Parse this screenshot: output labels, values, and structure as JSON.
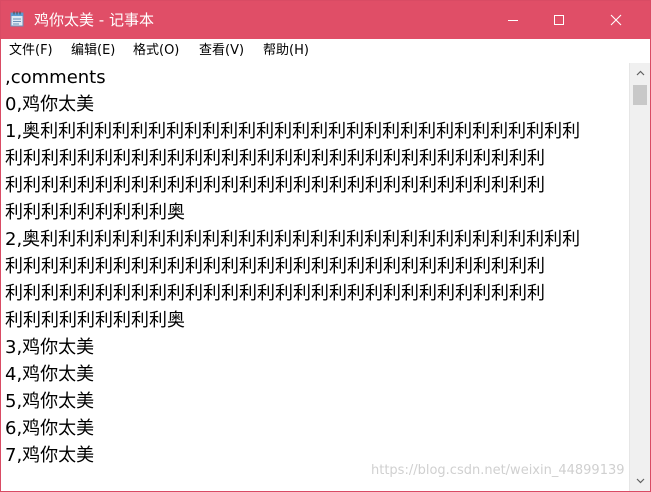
{
  "window": {
    "title": "鸡你太美 - 记事本"
  },
  "menu": {
    "file": "文件(F)",
    "edit": "编辑(E)",
    "format": "格式(O)",
    "view": "查看(V)",
    "help": "帮助(H)"
  },
  "editor": {
    "lines": [
      ",comments",
      "0,鸡你太美",
      "1,奥利利利利利利利利利利利利利利利利利利利利利利利利利利利利利利",
      "利利利利利利利利利利利利利利利利利利利利利利利利利利利利利利",
      "利利利利利利利利利利利利利利利利利利利利利利利利利利利利利利",
      "利利利利利利利利利奥",
      "2,奥利利利利利利利利利利利利利利利利利利利利利利利利利利利利利利",
      "利利利利利利利利利利利利利利利利利利利利利利利利利利利利利利",
      "利利利利利利利利利利利利利利利利利利利利利利利利利利利利利利",
      "利利利利利利利利利奥",
      "3,鸡你太美",
      "4,鸡你太美",
      "5,鸡你太美",
      "6,鸡你太美",
      "7,鸡你太美"
    ]
  },
  "watermark": "https://blog.csdn.net/weixin_44899139",
  "icons": {
    "app": "notepad-icon",
    "minimize": "minimize-icon",
    "maximize": "maximize-icon",
    "close": "close-icon",
    "scroll_up": "chevron-up-icon",
    "scroll_down": "chevron-down-icon"
  },
  "colors": {
    "titlebar": "#e04e67",
    "title_text": "#ffffff"
  }
}
